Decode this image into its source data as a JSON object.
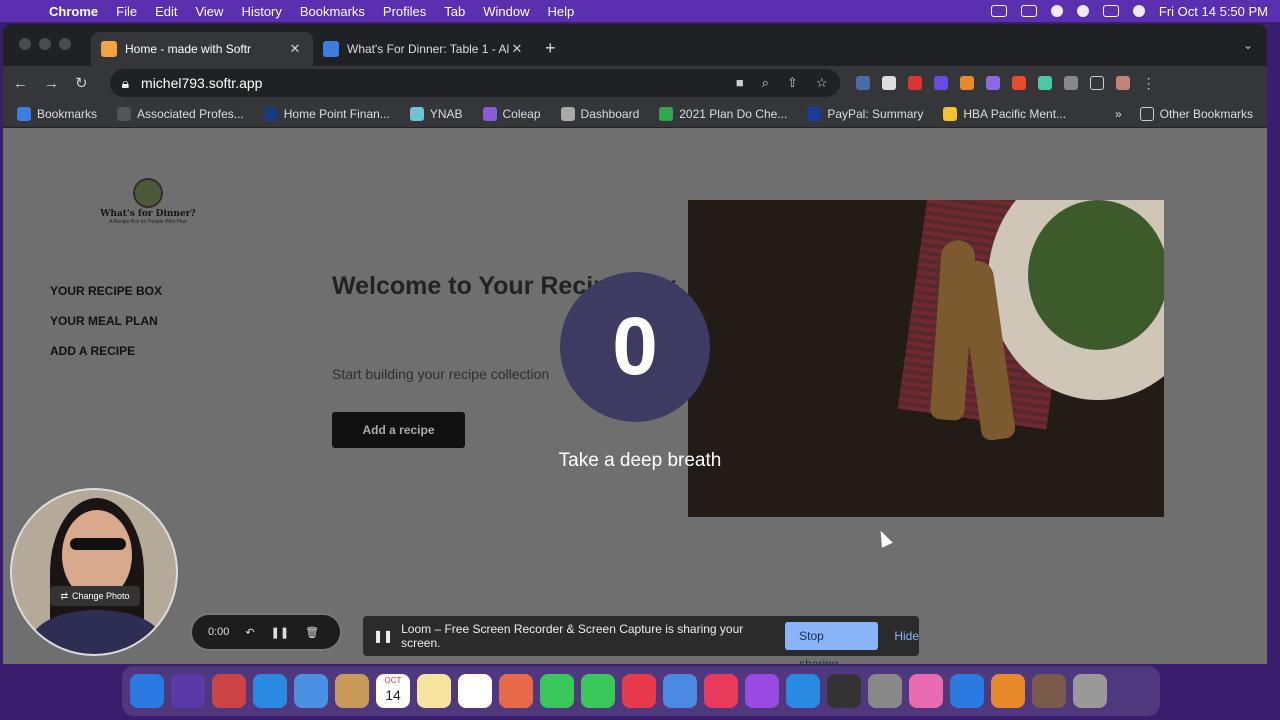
{
  "menubar": {
    "app": "Chrome",
    "items": [
      "File",
      "Edit",
      "View",
      "History",
      "Bookmarks",
      "Profiles",
      "Tab",
      "Window",
      "Help"
    ],
    "datetime": "Fri Oct 14  5:50 PM"
  },
  "tabs": [
    {
      "title": "Home - made with Softr",
      "favicon_color": "#f4a340"
    },
    {
      "title": "What's For Dinner: Table 1 - Al",
      "favicon_color": "#3b7de0"
    }
  ],
  "address_bar": {
    "url": "michel793.softr.app"
  },
  "bookmarks": [
    {
      "label": "Bookmarks",
      "color": "#3b7de0"
    },
    {
      "label": "Associated Profes...",
      "color": "#555555"
    },
    {
      "label": "Home Point Finan...",
      "color": "#1a3b7a"
    },
    {
      "label": "YNAB",
      "color": "#6cc5d6"
    },
    {
      "label": "Coleap",
      "color": "#8a5ad8"
    },
    {
      "label": "Dashboard",
      "color": "#aaaaaa"
    },
    {
      "label": "2021 Plan Do Che...",
      "color": "#2fa84f"
    },
    {
      "label": "PayPal: Summary",
      "color": "#1a3b9a"
    },
    {
      "label": "HBA Pacific Ment...",
      "color": "#f4c430"
    }
  ],
  "bookmarks_other": "Other Bookmarks",
  "page": {
    "logo_title": "What's for Dinner?",
    "logo_subtitle": "A Recipe Box for People Who Plan",
    "nav": [
      "YOUR RECIPE BOX",
      "YOUR MEAL PLAN",
      "ADD A RECIPE"
    ],
    "hero_title": "Welcome to Your Recipe Box.",
    "hero_subtitle": "Start building your recipe collection",
    "hero_button": "Add a recipe"
  },
  "overlay": {
    "countdown": "0",
    "message": "Take a deep breath"
  },
  "loom": {
    "change_photo": "Change Photo",
    "timer": "0:00",
    "share_message": "Loom – Free Screen Recorder & Screen Capture is sharing your screen.",
    "stop_button": "Stop sharing",
    "hide_button": "Hide"
  },
  "dock": {
    "calendar_month": "OCT",
    "calendar_day": "14",
    "icon_colors": [
      "#2a7ae2",
      "#5a3aa8",
      "#c44",
      "#2a8ae2",
      "#4a90e2",
      "#c89a5a",
      "#ffffff",
      "#f6e3a0",
      "#ffffff",
      "#e86a4a",
      "#3ac85a",
      "#3ac85a",
      "#e83a4a",
      "#4a8ae2",
      "#e83a5a",
      "#9a4ae2",
      "#2a8ae2",
      "#333333",
      "#888888",
      "#e86ab0",
      "#2a7ae2",
      "#e88a2a",
      "#7a5a4a",
      "#999999"
    ]
  }
}
